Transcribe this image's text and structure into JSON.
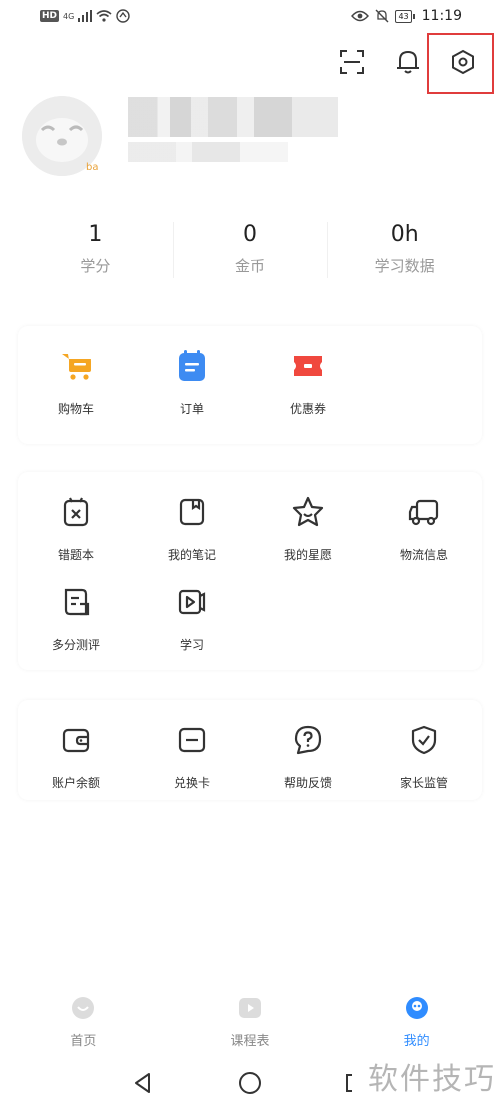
{
  "status_bar": {
    "hd": "HD",
    "network": "4G",
    "battery": "43",
    "time": "11:19"
  },
  "profile": {
    "badge": "ba"
  },
  "stats": [
    {
      "value": "1",
      "label": "学分"
    },
    {
      "value": "0",
      "label": "金币"
    },
    {
      "value": "0h",
      "label": "学习数据"
    }
  ],
  "shop_section": {
    "items": [
      {
        "label": "购物车",
        "icon": "shopping-cart-icon",
        "color": "#f5a623"
      },
      {
        "label": "订单",
        "icon": "order-icon",
        "color": "#3d8bf2"
      },
      {
        "label": "优惠券",
        "icon": "coupon-icon",
        "color": "#f0483e"
      }
    ]
  },
  "study_section": {
    "items": [
      {
        "label": "错题本",
        "icon": "wrong-question-book-icon"
      },
      {
        "label": "我的笔记",
        "icon": "notes-icon"
      },
      {
        "label": "我的星愿",
        "icon": "star-wish-icon"
      },
      {
        "label": "物流信息",
        "icon": "logistics-truck-icon"
      },
      {
        "label": "多分测评",
        "icon": "assessment-icon"
      },
      {
        "label": "学习",
        "icon": "video-study-icon"
      }
    ]
  },
  "account_section": {
    "items": [
      {
        "label": "账户余额",
        "icon": "wallet-icon"
      },
      {
        "label": "兑换卡",
        "icon": "redeem-card-icon"
      },
      {
        "label": "帮助反馈",
        "icon": "help-feedback-icon"
      },
      {
        "label": "家长监管",
        "icon": "parental-control-shield-icon"
      }
    ]
  },
  "bottom_nav": [
    {
      "label": "首页",
      "icon": "home-icon"
    },
    {
      "label": "课程表",
      "icon": "schedule-icon"
    },
    {
      "label": "我的",
      "icon": "my-icon",
      "active": true
    }
  ],
  "watermark": "软件技巧",
  "colors": {
    "accent": "#2f8cff",
    "highlight": "#e03c3c"
  }
}
